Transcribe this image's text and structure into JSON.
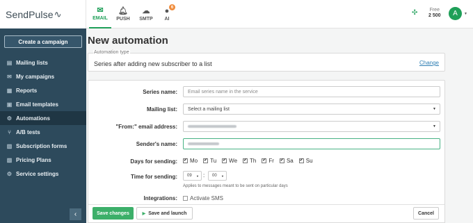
{
  "brand": {
    "name": "SendPulse",
    "pulse_glyph": "⁄∿"
  },
  "sidebar": {
    "create_button": "Create a campaign",
    "items": [
      {
        "label": "Mailing lists",
        "icon": "list-icon"
      },
      {
        "label": "My campaigns",
        "icon": "envelope-icon"
      },
      {
        "label": "Reports",
        "icon": "chart-icon"
      },
      {
        "label": "Email templates",
        "icon": "template-icon"
      },
      {
        "label": "Automations",
        "icon": "gear-flow-icon",
        "active": true
      },
      {
        "label": "A/B tests",
        "icon": "split-icon"
      },
      {
        "label": "Subscription forms",
        "icon": "form-icon"
      },
      {
        "label": "Pricing Plans",
        "icon": "tag-icon"
      },
      {
        "label": "Service settings",
        "icon": "settings-icon"
      }
    ],
    "collapse_glyph": "‹"
  },
  "topbar": {
    "tabs": [
      {
        "label": "EMAIL",
        "icon": "envelope-icon",
        "active": true
      },
      {
        "label": "PUSH",
        "icon": "bell-icon"
      },
      {
        "label": "SMTP",
        "icon": "cloud-icon"
      },
      {
        "label": "AI",
        "icon": "chat-icon",
        "badge": "6"
      }
    ],
    "plan_name": "Free",
    "plan_count": "2 500",
    "avatar_letter": "A"
  },
  "page": {
    "title": "New automation",
    "automation_type": {
      "label": "Automation type",
      "value": "Series after adding new subscriber to a list",
      "change_link": "Change"
    },
    "form": {
      "series_name": {
        "label": "Series name:",
        "placeholder": "Email series name in the service"
      },
      "mailing_list": {
        "label": "Mailing list:",
        "value": "Select a mailing list"
      },
      "from_email": {
        "label": "\"From:\" email address:"
      },
      "sender_name": {
        "label": "Sender's name:"
      },
      "days": {
        "label": "Days for sending:",
        "options": [
          "Mo",
          "Tu",
          "We",
          "Th",
          "Fr",
          "Sa",
          "Su"
        ]
      },
      "time": {
        "label": "Time for sending:",
        "hour": "09",
        "minute": "00",
        "separator": ":",
        "hint": "Applies to messages meant to be sent on particular days"
      },
      "integrations": {
        "label": "Integrations:",
        "sms_label": "Activate SMS"
      }
    },
    "footer": {
      "save": "Save changes",
      "save_launch": "Save and launch",
      "cancel": "Cancel"
    }
  },
  "colors": {
    "accent": "#1e9f58",
    "sidebar_bg": "#2d4a5c",
    "link": "#2e7eb3"
  }
}
